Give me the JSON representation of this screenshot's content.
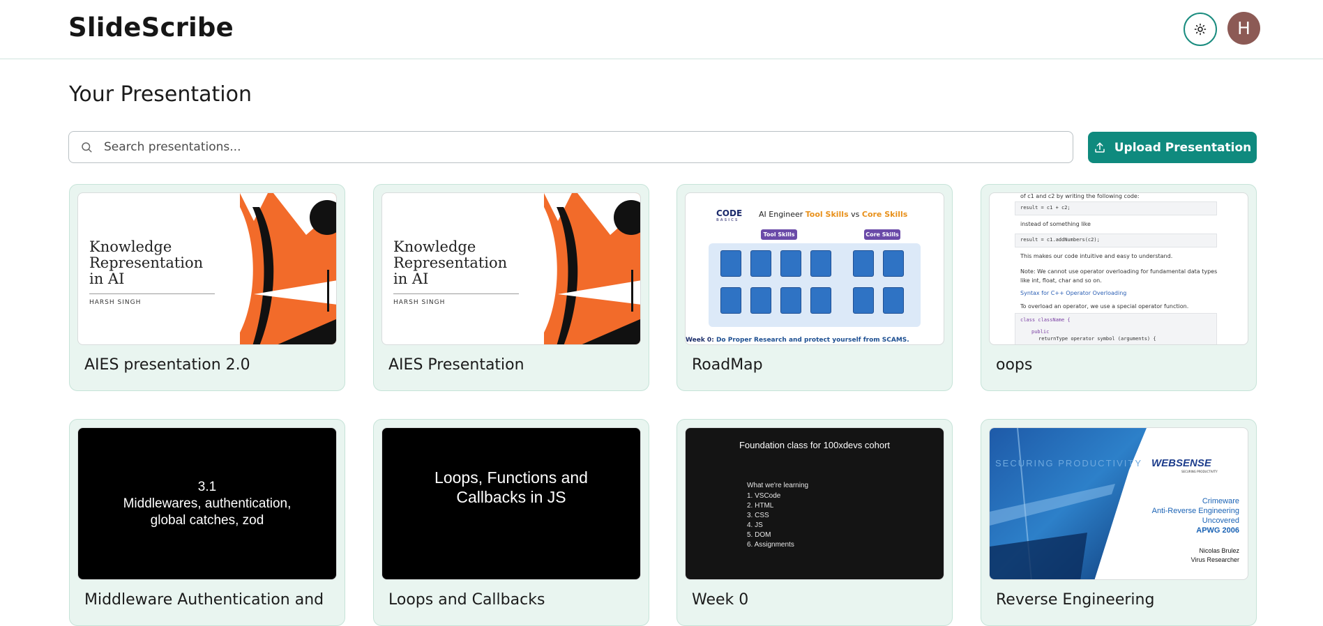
{
  "header": {
    "logo": "SlideScribe",
    "avatar_initial": "H",
    "theme_icon": "sun-icon"
  },
  "main": {
    "title": "Your Presentation",
    "search": {
      "placeholder": "Search presentations..."
    },
    "upload_label": "Upload Presentation"
  },
  "presentations": [
    {
      "name": "AIES presentation 2.0",
      "slide": {
        "title": [
          "Knowledge",
          "Representation",
          "in AI"
        ],
        "author": "HARSH SINGH"
      }
    },
    {
      "name": "AIES Presentation",
      "slide": {
        "title": [
          "Knowledge",
          "Representation",
          "in AI"
        ],
        "author": "HARSH SINGH"
      }
    },
    {
      "name": "RoadMap",
      "slide": {
        "heading_a": "AI Engineer",
        "heading_b": "Tool Skills",
        "heading_c": "vs",
        "heading_d": "Core Skills",
        "tag_a": "Tool Skills",
        "tag_b": "Core Skills",
        "logo": "CODE",
        "logo_sub": "BASICS",
        "footer_a": "Week 0:",
        "footer_b": "Do Proper Research and protect yourself from SCAMS."
      }
    },
    {
      "name": "oops",
      "slide": {
        "lines": [
          "of c1 and c2 by writing the following code:",
          "result = c1 + c2;",
          "instead of something like",
          "result = c1.addNumbers(c2);",
          "This makes our code intuitive and easy to understand.",
          "Note: We cannot use operator overloading for fundamental data types",
          "like int, float, char and so on.",
          "Syntax for C++ Operator Overloading",
          "To overload an operator, we use a special operator function.",
          "class className {",
          "public",
          "returnType operator symbol (arguments) {"
        ]
      }
    },
    {
      "name": "Middleware Authentication and",
      "slide": {
        "lines": [
          "3.1",
          "Middlewares, authentication,",
          "global catches, zod"
        ]
      }
    },
    {
      "name": "Loops and Callbacks",
      "slide": {
        "lines": [
          "Loops, Functions and",
          "Callbacks in JS"
        ]
      }
    },
    {
      "name": "Week 0",
      "slide": {
        "title": "Foundation class for 100xdevs cohort",
        "subtitle": "What we're learning",
        "items": [
          "1. VSCode",
          "2. HTML",
          "3. CSS",
          "4. JS",
          "5. DOM",
          "6. Assignments"
        ]
      }
    },
    {
      "name": "Reverse Engineering",
      "slide": {
        "banner": "SECURING PRODUCTIVITY",
        "brand": "WEBSENSE",
        "brand_sub": "SECURING PRODUCTIVITY",
        "lines": [
          "Crimeware",
          "Anti-Reverse Engineering",
          "Uncovered"
        ],
        "event": "APWG 2006",
        "author": "Nicolas Brulez",
        "role": "Virus Researcher"
      }
    }
  ],
  "colors": {
    "accent": "#0f8a7e",
    "card_bg": "#e9f5f0",
    "avatar_bg": "#8c5a55"
  }
}
